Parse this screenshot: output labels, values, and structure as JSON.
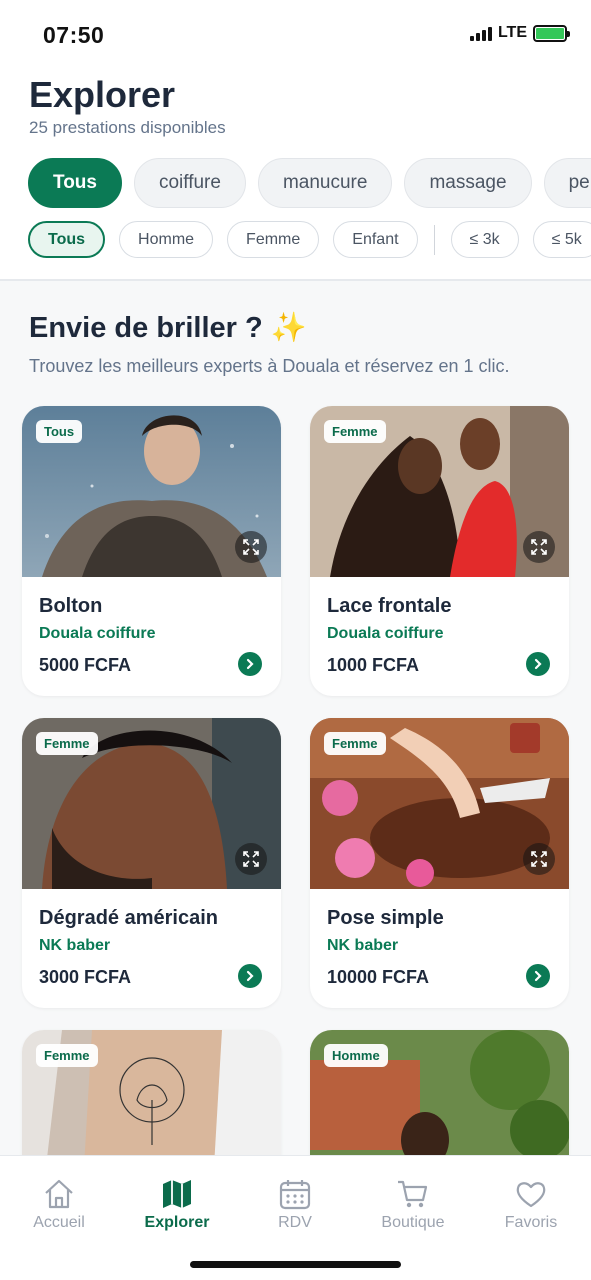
{
  "status": {
    "time": "07:50",
    "network": "LTE"
  },
  "header": {
    "title": "Explorer",
    "subtitle": "25 prestations disponibles"
  },
  "categories": [
    {
      "label": "Tous",
      "active": true
    },
    {
      "label": "coiffure",
      "active": false
    },
    {
      "label": "manucure",
      "active": false
    },
    {
      "label": "massage",
      "active": false
    },
    {
      "label": "pe",
      "active": false
    }
  ],
  "filters": {
    "gender": [
      {
        "label": "Tous",
        "active": true
      },
      {
        "label": "Homme",
        "active": false
      },
      {
        "label": "Femme",
        "active": false
      },
      {
        "label": "Enfant",
        "active": false
      }
    ],
    "price": [
      "≤ 3k",
      "≤ 5k"
    ]
  },
  "promo": {
    "title": "Envie de briller ? ✨",
    "subtitle": "Trouvez les meilleurs experts à Douala et réservez en 1 clic."
  },
  "services": [
    {
      "badge": "Tous",
      "name": "Bolton",
      "shop": "Douala coiffure",
      "price": "5000 FCFA"
    },
    {
      "badge": "Femme",
      "name": "Lace frontale",
      "shop": "Douala coiffure",
      "price": "1000 FCFA"
    },
    {
      "badge": "Femme",
      "name": "Dégradé américain",
      "shop": "NK baber",
      "price": "3000 FCFA"
    },
    {
      "badge": "Femme",
      "name": "Pose simple",
      "shop": "NK baber",
      "price": "10000 FCFA"
    },
    {
      "badge": "Femme",
      "name": "",
      "shop": "",
      "price": ""
    },
    {
      "badge": "Homme",
      "name": "",
      "shop": "",
      "price": ""
    }
  ],
  "nav": [
    {
      "label": "Accueil",
      "icon": "home-icon",
      "active": false
    },
    {
      "label": "Explorer",
      "icon": "map-icon",
      "active": true
    },
    {
      "label": "RDV",
      "icon": "calendar-icon",
      "active": false
    },
    {
      "label": "Boutique",
      "icon": "cart-icon",
      "active": false
    },
    {
      "label": "Favoris",
      "icon": "heart-icon",
      "active": false
    }
  ],
  "colors": {
    "accent": "#0b7a55",
    "text": "#1e293b",
    "muted": "#64748b"
  }
}
